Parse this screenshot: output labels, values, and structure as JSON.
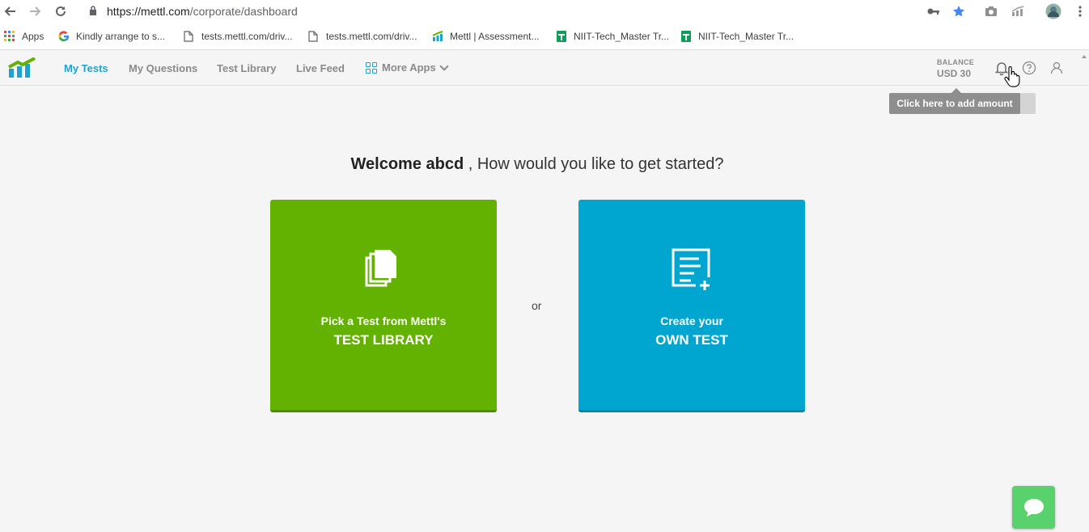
{
  "browser": {
    "url_host": "https://mettl.com",
    "url_path": "/corporate/dashboard",
    "bookmarks": [
      {
        "label": "Apps",
        "icon": "apps-grid-icon"
      },
      {
        "label": "Kindly arrange to s...",
        "icon": "google-icon"
      },
      {
        "label": "tests.mettl.com/driv...",
        "icon": "page-icon"
      },
      {
        "label": "tests.mettl.com/driv...",
        "icon": "page-icon"
      },
      {
        "label": "Mettl | Assessment...",
        "icon": "mettl-icon"
      },
      {
        "label": "NIIT-Tech_Master Tr...",
        "icon": "sheets-icon"
      },
      {
        "label": "NIIT-Tech_Master Tr...",
        "icon": "sheets-icon"
      }
    ]
  },
  "header": {
    "nav": [
      {
        "label": "My Tests",
        "active": true
      },
      {
        "label": "My Questions",
        "active": false
      },
      {
        "label": "Test Library",
        "active": false
      },
      {
        "label": "Live Feed",
        "active": false
      }
    ],
    "more_apps": "More Apps",
    "balance_label": "BALANCE",
    "balance_amount": "USD 30",
    "tooltip": "Click here to add amount"
  },
  "main": {
    "welcome_name": "Welcome abcd",
    "welcome_rest": ", How would you like to get started?",
    "or": "or",
    "cards": [
      {
        "line1": "Pick a Test from Mettl's",
        "line2": "TEST LIBRARY"
      },
      {
        "line1": "Create your",
        "line2": "OWN TEST"
      }
    ]
  },
  "colors": {
    "accent": "#1ea2d2",
    "green_card": "#63b100",
    "blue_card": "#00a6cf",
    "chat": "#59d16c"
  }
}
